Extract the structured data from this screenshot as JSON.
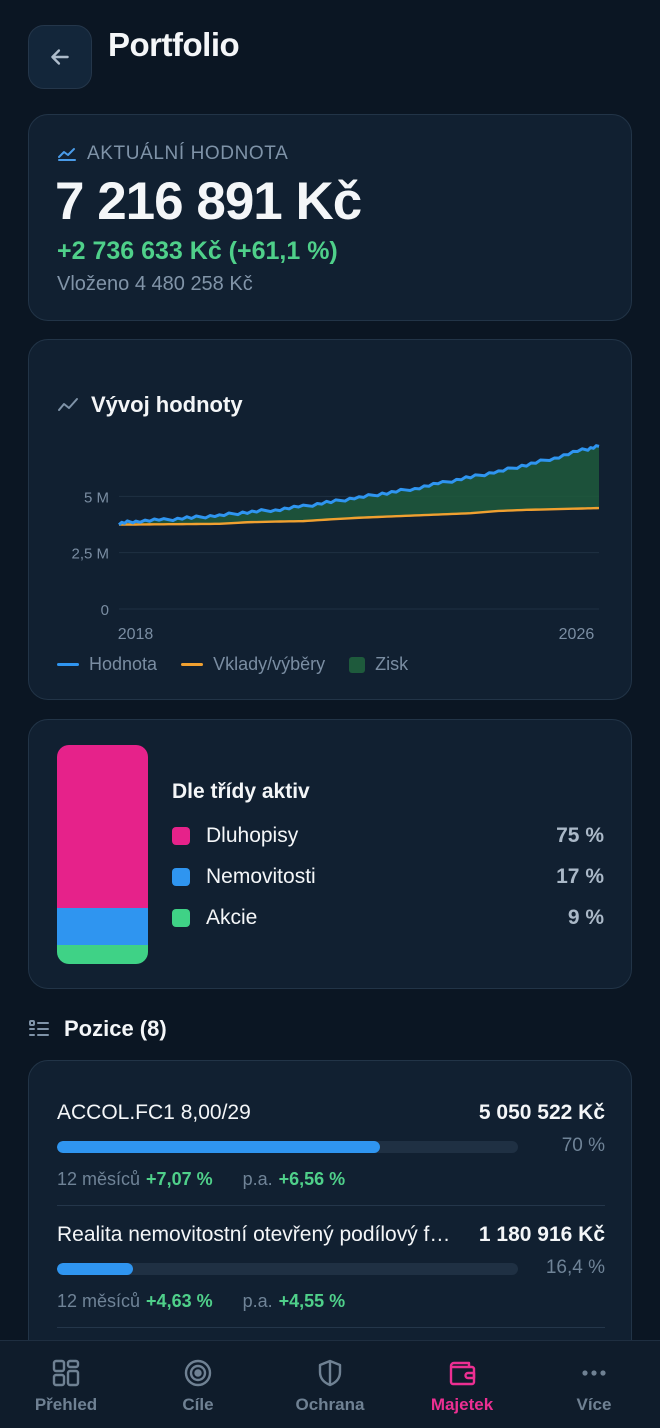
{
  "header": {
    "title": "Portfolio",
    "back_icon": "arrow-left-icon"
  },
  "value_card": {
    "label": "AKTUÁLNÍ HODNOTA",
    "amount": "7 216 891 Kč",
    "gain": "+2 736 633 Kč (+61,1 %)",
    "invested": "Vloženo 4 480 258 Kč"
  },
  "chart": {
    "title": "Vývoj hodnoty",
    "colors": {
      "value": "#2f95f0",
      "deposits": "#f0a030",
      "profit": "#1e5a3c"
    }
  },
  "chart_data": {
    "type": "area",
    "x_ticks": [
      "2018",
      "2026"
    ],
    "y_ticks": [
      "0",
      "2,5 M",
      "5 M"
    ],
    "ylim": [
      0,
      7500000
    ],
    "x": [
      2017.7,
      2018.0,
      2018.5,
      2019.0,
      2019.5,
      2020.0,
      2020.5,
      2021.0,
      2021.5,
      2022.0,
      2022.5,
      2023.0,
      2023.5,
      2024.0,
      2024.5,
      2025.0,
      2025.5,
      2026.0,
      2026.3
    ],
    "series": [
      {
        "name": "Hodnota",
        "values": [
          3800000,
          3900000,
          3950000,
          4050000,
          4150000,
          4300000,
          4400000,
          4550000,
          4750000,
          4950000,
          5150000,
          5350000,
          5600000,
          5850000,
          6100000,
          6400000,
          6700000,
          7050000,
          7216891
        ]
      },
      {
        "name": "Vklady/výběry",
        "values": [
          3750000,
          3750000,
          3760000,
          3770000,
          3780000,
          3850000,
          3880000,
          3900000,
          3980000,
          4050000,
          4100000,
          4150000,
          4200000,
          4250000,
          4350000,
          4400000,
          4430000,
          4460000,
          4480258
        ]
      },
      {
        "name": "Zisk",
        "values": []
      }
    ],
    "legend": [
      "Hodnota",
      "Vklady/výběry",
      "Zisk"
    ],
    "legend_position": "bottom-left",
    "grid": true
  },
  "allocation": {
    "title": "Dle třídy aktiv",
    "items": [
      {
        "label": "Dluhopisy",
        "pct": "75 %",
        "share": 0.75,
        "color": "#e6228a"
      },
      {
        "label": "Nemovitosti",
        "pct": "17 %",
        "share": 0.16,
        "color": "#2f95f0"
      },
      {
        "label": "Akcie",
        "pct": "9 %",
        "share": 0.09,
        "color": "#3fd286"
      }
    ]
  },
  "positions": {
    "title": "Pozice (8)",
    "items": [
      {
        "name": "ACCOL.FC1 8,00/29",
        "value": "5 050 522 Kč",
        "share": "70 %",
        "fill": 0.7,
        "period_label": "12 měsíců",
        "period_return": "+7,07 %",
        "pa_label": "p.a.",
        "pa_return": "+6,56 %"
      },
      {
        "name": "Realita nemovitostní otevřený podílový fond",
        "value": "1 180 916 Kč",
        "share": "16,4 %",
        "fill": 0.164,
        "period_label": "12 měsíců",
        "period_return": "+4,63 %",
        "pa_label": "p.a.",
        "pa_return": "+4,55 %"
      }
    ]
  },
  "nav": {
    "items": [
      {
        "label": "Přehled",
        "icon": "grid-icon"
      },
      {
        "label": "Cíle",
        "icon": "target-icon"
      },
      {
        "label": "Ochrana",
        "icon": "shield-icon"
      },
      {
        "label": "Majetek",
        "icon": "wallet-icon",
        "active": true
      },
      {
        "label": "Více",
        "icon": "more-icon"
      }
    ]
  }
}
